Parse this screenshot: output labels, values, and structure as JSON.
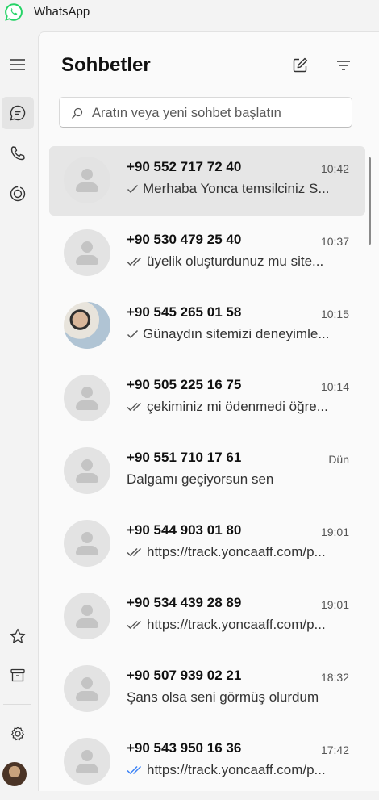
{
  "app": {
    "title": "WhatsApp"
  },
  "colors": {
    "brand": "#25D366",
    "read_tick": "#3b82f6",
    "background": "#f3f3f3",
    "selected": "#e6e6e6"
  },
  "header": {
    "title": "Sohbetler",
    "new_chat_icon": "compose-icon",
    "filter_icon": "filter-icon"
  },
  "search": {
    "placeholder": "Aratın veya yeni sohbet başlatın"
  },
  "rail": {
    "top": [
      "menu-icon",
      "chats-icon",
      "calls-icon",
      "status-icon"
    ],
    "bottom": [
      "starred-icon",
      "archive-icon",
      "settings-icon",
      "profile-avatar"
    ]
  },
  "chats": [
    {
      "name": "+90 552 717 72 40",
      "time": "10:42",
      "tick": "single",
      "preview": "Merhaba Yonca temsilciniz S..."
    },
    {
      "name": "+90 530 479 25 40",
      "time": "10:37",
      "tick": "double",
      "preview": "üyelik oluşturdunuz mu site..."
    },
    {
      "name": "+90 545 265 01 58",
      "time": "10:15",
      "tick": "single",
      "preview": "Günaydın sitemizi deneyimle..."
    },
    {
      "name": "+90 505 225 16 75",
      "time": "10:14",
      "tick": "double",
      "preview": "çekiminiz mi ödenmedi öğre..."
    },
    {
      "name": "+90 551 710 17 61",
      "time": "Dün",
      "tick": "none",
      "preview": "Dalgamı geçiyorsun sen"
    },
    {
      "name": "+90 544 903 01 80",
      "time": "19:01",
      "tick": "double",
      "preview": "https://track.yoncaaff.com/p..."
    },
    {
      "name": "+90 534 439 28 89",
      "time": "19:01",
      "tick": "double",
      "preview": "https://track.yoncaaff.com/p..."
    },
    {
      "name": "+90 507 939 02 21",
      "time": "18:32",
      "tick": "none",
      "preview": "Şans olsa seni görmüş olurdum"
    },
    {
      "name": "+90 543 950 16 36",
      "time": "17:42",
      "tick": "read",
      "preview": "https://track.yoncaaff.com/p..."
    }
  ]
}
